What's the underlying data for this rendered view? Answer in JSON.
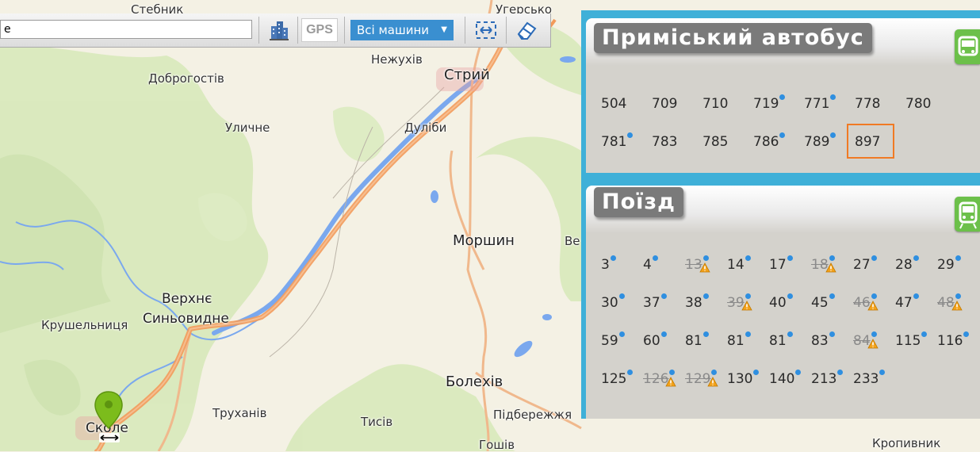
{
  "map": {
    "places": [
      {
        "name": "Стебник",
        "cls": "l1"
      },
      {
        "name": "Угерсько",
        "cls": "l1"
      },
      {
        "name": "Нежухів",
        "cls": "l1"
      },
      {
        "name": "Доброгостів",
        "cls": "l1"
      },
      {
        "name": "Стрий",
        "cls": "l3"
      },
      {
        "name": "Уличне",
        "cls": "l1"
      },
      {
        "name": "Дуліби",
        "cls": "l1"
      },
      {
        "name": "Моршин",
        "cls": "l3"
      },
      {
        "name": "Верхнє",
        "cls": "l2"
      },
      {
        "name": "Синьовидне",
        "cls": "l2"
      },
      {
        "name": "Крушельниця",
        "cls": "l1"
      },
      {
        "name": "Болехів",
        "cls": "l3"
      },
      {
        "name": "Труханів",
        "cls": "l1"
      },
      {
        "name": "Тисів",
        "cls": "l1"
      },
      {
        "name": "Підбережжя",
        "cls": "l1"
      },
      {
        "name": "Сколе",
        "cls": "l2"
      },
      {
        "name": "Гошів",
        "cls": "l1"
      },
      {
        "name": "Кропивник",
        "cls": "l1"
      },
      {
        "name": "Ве",
        "cls": "l1"
      }
    ]
  },
  "toolbar": {
    "search_value": "e",
    "gps_label": "GPS",
    "vehicles_label": "Всі машини",
    "vehicles_icon": "chevron-down-icon"
  },
  "suburban_bus": {
    "title": "Приміський автобус",
    "routes": [
      {
        "label": "504",
        "dot": false
      },
      {
        "label": "709",
        "dot": false
      },
      {
        "label": "710",
        "dot": false
      },
      {
        "label": "719",
        "dot": true
      },
      {
        "label": "771",
        "dot": true
      },
      {
        "label": "778",
        "dot": false
      },
      {
        "label": "780",
        "dot": false
      },
      {
        "label": "781",
        "dot": true
      },
      {
        "label": "783",
        "dot": false
      },
      {
        "label": "785",
        "dot": false
      },
      {
        "label": "786",
        "dot": true
      },
      {
        "label": "789",
        "dot": true
      },
      {
        "label": "897",
        "dot": false,
        "selected": true
      }
    ]
  },
  "train": {
    "title": "Поїзд",
    "routes": [
      {
        "label": "3",
        "dot": true
      },
      {
        "label": "4",
        "dot": true
      },
      {
        "label": "13",
        "dot": true,
        "disabled": true,
        "warning": true
      },
      {
        "label": "14",
        "dot": true
      },
      {
        "label": "17",
        "dot": true
      },
      {
        "label": "18",
        "dot": true,
        "disabled": true,
        "warning": true
      },
      {
        "label": "27",
        "dot": true
      },
      {
        "label": "28",
        "dot": true
      },
      {
        "label": "29",
        "dot": true
      },
      {
        "label": "30",
        "dot": true
      },
      {
        "label": "37",
        "dot": true
      },
      {
        "label": "38",
        "dot": true
      },
      {
        "label": "39",
        "dot": true,
        "disabled": true,
        "warning": true
      },
      {
        "label": "40",
        "dot": true
      },
      {
        "label": "45",
        "dot": true
      },
      {
        "label": "46",
        "dot": true,
        "disabled": true,
        "warning": true
      },
      {
        "label": "47",
        "dot": true
      },
      {
        "label": "48",
        "dot": true,
        "disabled": true,
        "warning": true
      },
      {
        "label": "59",
        "dot": true
      },
      {
        "label": "60",
        "dot": true
      },
      {
        "label": "81",
        "dot": true
      },
      {
        "label": "81",
        "dot": true
      },
      {
        "label": "81",
        "dot": true
      },
      {
        "label": "83",
        "dot": true
      },
      {
        "label": "84",
        "dot": true,
        "disabled": true,
        "warning": true
      },
      {
        "label": "115",
        "dot": true
      },
      {
        "label": "116",
        "dot": true
      },
      {
        "label": "125",
        "dot": true
      },
      {
        "label": "126",
        "dot": true,
        "disabled": true,
        "warning": true
      },
      {
        "label": "129",
        "dot": true,
        "disabled": true,
        "warning": true
      },
      {
        "label": "130",
        "dot": true
      },
      {
        "label": "140",
        "dot": true
      },
      {
        "label": "213",
        "dot": true
      },
      {
        "label": "233",
        "dot": true
      }
    ]
  },
  "colors": {
    "panel_border": "#3fb0d8",
    "route_dot": "#2f8fe0",
    "selected_outline": "#f07a24",
    "badge": "#6cc04a",
    "map_road": "#f0a060",
    "map_water": "#7aa8ee",
    "map_green": "#d6e7b8"
  }
}
